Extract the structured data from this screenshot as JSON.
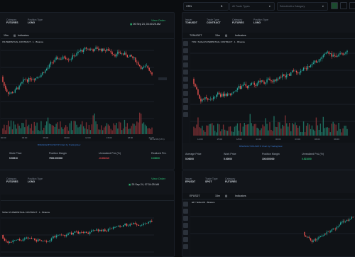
{
  "topbar": {
    "select1": {
      "value": "ORN",
      "suffix": "B"
    },
    "select2": {
      "placeholder": "All Trade Types"
    },
    "select3": {
      "placeholder": "Select/edit a Category"
    }
  },
  "panels": {
    "tl": {
      "category_label": "Category",
      "category_value": "FUTURES",
      "position_label": "Position Type",
      "position_value": "LONG",
      "view_order": "View Order",
      "timestamp": "06 Sep 24, 04:40:25 AM",
      "pair": "OS PERPETUAL CONTRACT · 1 · Binance",
      "tf": "15m",
      "indicators": "Indicators",
      "xaxis": [
        "00:00",
        "03:00",
        "06:00",
        "09:00",
        "12:00",
        "15:00",
        "18:00",
        "21:00",
        "00:00"
      ],
      "foot": "BINANCE:BTCUSDT.P Chart by TradingView",
      "foot2": "05:12:08 (UTC)",
      "metrics": [
        {
          "k": "Work Price",
          "v": "5.50910",
          "c": "#cfd6dd"
        },
        {
          "k": "Position Margin",
          "v": "7500.000000",
          "c": "#cfd6dd"
        },
        {
          "k": "Unrealized PnL (%)",
          "v": "-0.601010",
          "c": "#e5484d"
        },
        {
          "k": "Realized PnL",
          "v": "0.00000",
          "c": "#2dbd74"
        }
      ]
    },
    "tr": {
      "issuer_label": "Issuer",
      "issuer_value": "TONUSDT",
      "trade_label": "Trade Type",
      "trade_value": "CONTRACT",
      "category_label": "Category",
      "category_value": "FUTURES",
      "position_label": "Position Type",
      "position_value": "LONG",
      "symbol": "TONUSDT",
      "tf": "15m",
      "indicators": "Indicators",
      "pair": "TON / TetherUS PERPETUAL CONTRACT · 1 · Binance",
      "xaxis": [
        "12:00",
        "15:00",
        "18:00",
        "21:00",
        "00:00",
        "03:00",
        "06:00",
        "09:00",
        "12:00"
      ],
      "foot": "BINANCE:TONUSDT.P Chart by TradingView",
      "metrics": [
        {
          "k": "Average Price",
          "v": "5.00000",
          "c": "#cfd6dd"
        },
        {
          "k": "Work Price",
          "v": "5.00000",
          "c": "#cfd6dd"
        },
        {
          "k": "Position Margin",
          "v": "100.000000",
          "c": "#cfd6dd"
        },
        {
          "k": "Unrealized PnL (%)",
          "v": "0.521000",
          "c": "#2dbd74"
        }
      ]
    },
    "bl": {
      "category_label": "Category",
      "category_value": "FUTURES",
      "position_label": "Position Type",
      "position_value": "LONG",
      "view_order": "View Order",
      "timestamp": "25 Sep 24, 07:34:25 AM",
      "pair": "Tether US PERPETUAL CONTRACT · 1 · Binance"
    },
    "br": {
      "issuer_label": "Issuer",
      "issuer_value": "EPUSDT",
      "trade_label": "Trade Type",
      "trade_value": "SPOT",
      "category_label": "Category",
      "category_value": "FUTURES",
      "symbol": "EPUSDT",
      "tf": "15m",
      "indicators": "Indicators",
      "pair": "EP / TetherUS · Binance"
    }
  }
}
